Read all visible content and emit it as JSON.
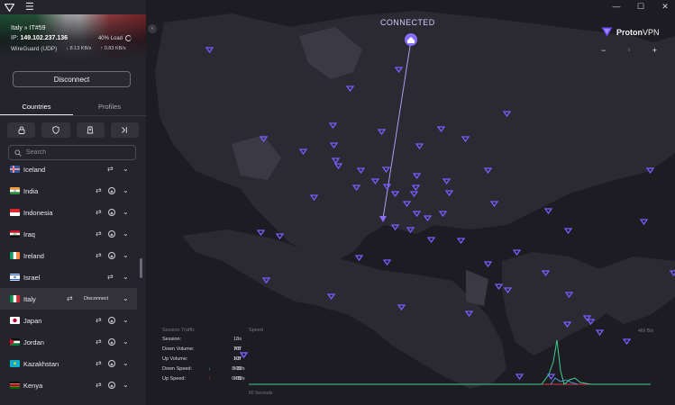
{
  "connection": {
    "status": "CONNECTED",
    "server": "Italy » IT#59",
    "ip_label": "IP:",
    "ip": "149.102.237.136",
    "load": "40% Load",
    "protocol": "WireGuard (UDP)",
    "down_rate": "8.13 KB/s",
    "up_rate": "0.83 KB/s",
    "disconnect_label": "Disconnect"
  },
  "tabs": [
    "Countries",
    "Profiles"
  ],
  "search": {
    "placeholder": "Search"
  },
  "countries": [
    {
      "name": "Iceland",
      "tor": false
    },
    {
      "name": "India",
      "tor": true
    },
    {
      "name": "Indonesia",
      "tor": true
    },
    {
      "name": "Iraq",
      "tor": true
    },
    {
      "name": "Ireland",
      "tor": true
    },
    {
      "name": "Israel",
      "tor": false
    },
    {
      "name": "Italy",
      "tor": false,
      "row_action": "Disconnect"
    },
    {
      "name": "Japan",
      "tor": true
    },
    {
      "name": "Jordan",
      "tor": true
    },
    {
      "name": "Kazakhstan",
      "tor": true
    },
    {
      "name": "Kenya",
      "tor": true
    }
  ],
  "brand": {
    "name_bold": "Proton",
    "name_light": "VPN"
  },
  "zoom": {
    "out": "−",
    "sep": "ı",
    "in": "+"
  },
  "window": {
    "minimize": "—",
    "maximize": "☐",
    "close": "✕"
  },
  "session": {
    "header": "Session Traffic",
    "rows": [
      {
        "label": "Session:",
        "value": "18s",
        "unit": ""
      },
      {
        "label": "Down Volume:",
        "value": "767",
        "unit": "KB"
      },
      {
        "label": "Up Volume:",
        "value": "197",
        "unit": "KB"
      },
      {
        "label": "Down Speed:",
        "value": "8.13",
        "unit": "KB/s",
        "arrow": "↓"
      },
      {
        "label": "Up Speed:",
        "value": "0.83",
        "unit": "KB/s",
        "arrow": "↑"
      }
    ]
  },
  "speed_chart": {
    "header": "Speed",
    "max_label": "466 B/s",
    "x_label": "60 Seconds"
  },
  "colors": {
    "accent": "#8a6cff",
    "down": "#3ecf8e",
    "up": "#d23b47"
  }
}
